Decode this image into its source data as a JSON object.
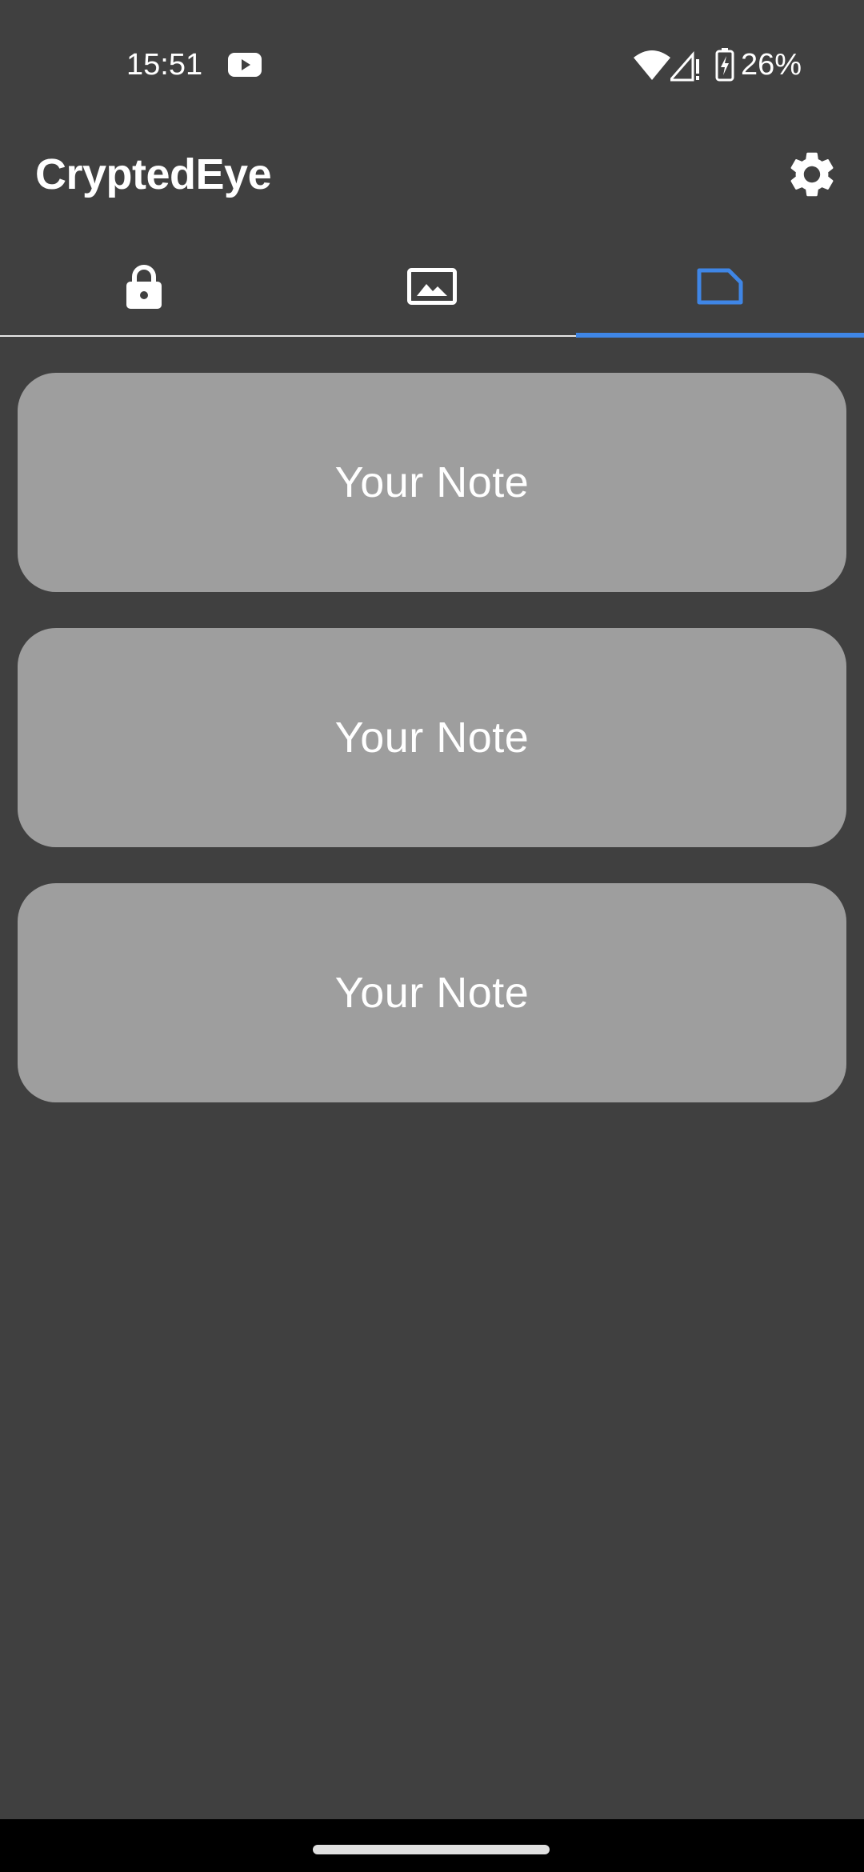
{
  "status_bar": {
    "time": "15:51",
    "battery_percent": "26%",
    "icons": [
      "youtube-icon",
      "wifi-icon",
      "signal-icon",
      "battery-charging-icon"
    ]
  },
  "app_bar": {
    "title": "CryptedEye",
    "settings_icon": "gear-icon"
  },
  "tabs": [
    {
      "icon": "lock-icon",
      "selected": false
    },
    {
      "icon": "image-icon",
      "selected": false
    },
    {
      "icon": "note-icon",
      "selected": true
    }
  ],
  "notes": [
    {
      "label": "Your Note"
    },
    {
      "label": "Your Note"
    },
    {
      "label": "Your Note"
    }
  ],
  "colors": {
    "background": "#404040",
    "card": "#9e9e9e",
    "accent": "#3f86e6",
    "text": "#ffffff"
  }
}
